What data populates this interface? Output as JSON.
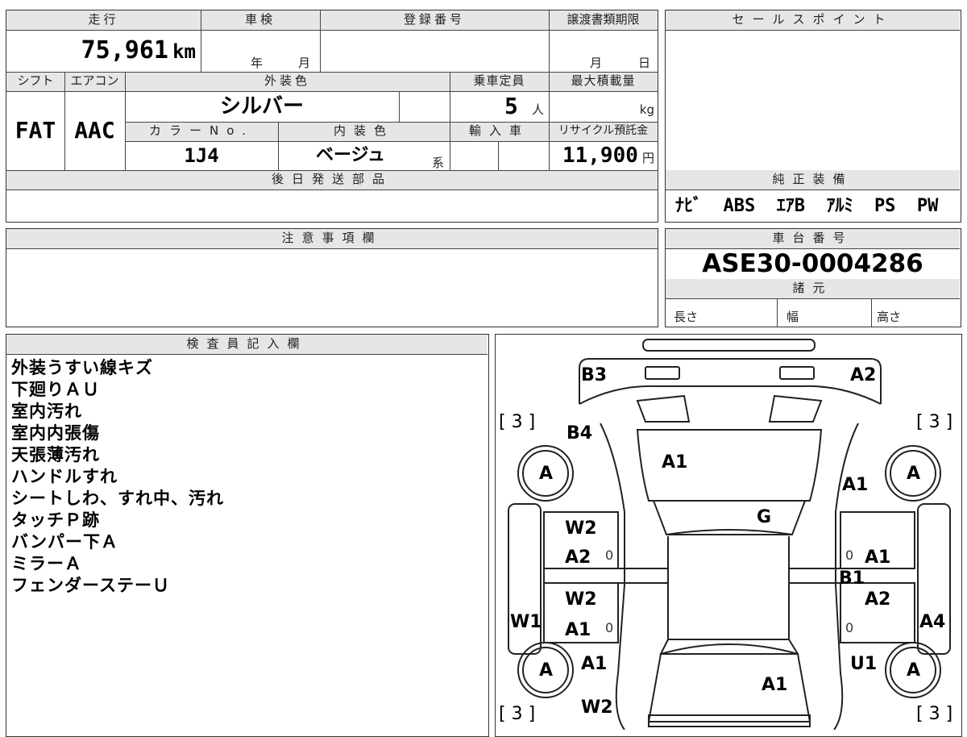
{
  "top_table": {
    "mileage_header": "走行",
    "mileage_value": "75,961",
    "mileage_unit": "km",
    "inspection_header": "車検",
    "inspection_year": "年",
    "inspection_month": "月",
    "registration_header": "登録番号",
    "deadline_header": "譲渡書類期限",
    "deadline_month": "月",
    "deadline_day": "日",
    "shift_header": "シフト",
    "aircon_header": "エアコン",
    "exterior_color_header": "外装色",
    "capacity_header": "乗車定員",
    "max_load_header": "最大積載量",
    "shift_value": "FAT",
    "aircon_value": "AAC",
    "exterior_color_value": "シルバー",
    "capacity_value": "5",
    "capacity_unit": "人",
    "load_unit": "kg",
    "color_no_header": "カラーNo.",
    "interior_color_header": "内装色",
    "import_header": "輸入車",
    "recycle_header": "リサイクル預託金",
    "color_no_value": "1J4",
    "interior_color_value": "ベージュ",
    "interior_suffix": "系",
    "recycle_value": "11,900",
    "recycle_unit": "円",
    "later_parts_header": "後日発送部品"
  },
  "sales_point": {
    "header": "セールスポイント"
  },
  "genuine_equipment": {
    "header": "純正装備",
    "value": "ﾅﾋﾞ  ABS  ｴｱB  ｱﾙﾐ  PS  PW"
  },
  "notes": {
    "header": "注意事項欄"
  },
  "chassis": {
    "header": "車台番号",
    "value": "ASE30-0004286"
  },
  "specs": {
    "header": "諸元",
    "length": "長さ",
    "width": "幅",
    "height": "高さ"
  },
  "inspector": {
    "header": "検査員記入欄",
    "lines": [
      "外装うすい線キズ",
      "下廻りＡＵ",
      "室内汚れ",
      "室内内張傷",
      "天張薄汚れ",
      "ハンドルすれ",
      "シートしわ、すれ中、汚れ",
      "タッチＰ跡",
      "バンパー下Ａ",
      "ミラーＡ",
      "フェンダーステーＵ"
    ]
  },
  "diagram": {
    "labels": {
      "b3": "B3",
      "a2_top": "A2",
      "b4": "B4",
      "a1_hood": "A1",
      "a1_right_fender": "A1",
      "g": "G",
      "w2_left_front": "W2",
      "a2_left_front": "A2",
      "a1_right_front_door": "A1",
      "b1": "B1",
      "w2_left_rear": "W2",
      "a2_right_rear_door": "A2",
      "w1": "W1",
      "a1_left_rear_door": "A1",
      "a4": "A4",
      "a1_left_quarter": "A1",
      "u1": "U1",
      "a1_trunk": "A1",
      "w2_bottom": "W2",
      "tire_a_fl": "A",
      "tire_a_fr": "A",
      "tire_a_rl": "A",
      "tire_a_rr": "A",
      "bracket_tl": "[ 3 ]",
      "bracket_tr": "[ 3 ]",
      "bracket_bl": "[ 3 ]",
      "bracket_br": "[ 3 ]",
      "zero_1": "0",
      "zero_2": "0",
      "zero_3": "0",
      "zero_4": "0"
    }
  }
}
